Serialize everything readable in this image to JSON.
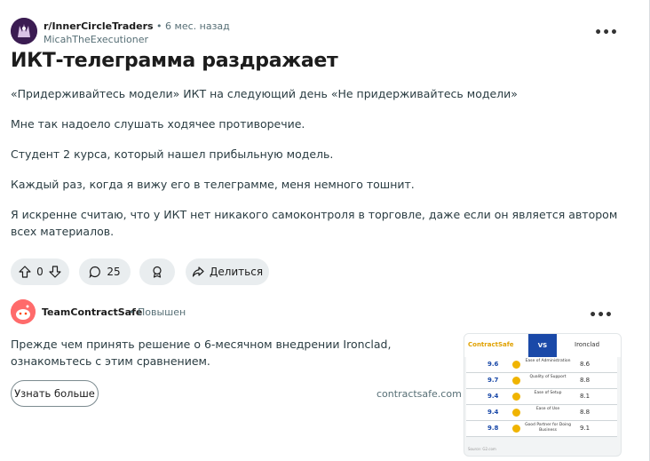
{
  "post": {
    "subreddit": "r/InnerCircleTraders",
    "separator": " • ",
    "age": "6 мес. назад",
    "author": "MicahTheExecutioner",
    "title": "ИКТ-телеграмма раздражает",
    "paragraphs": [
      "«Придерживайтесь модели» ИКТ на следующий день «Не придерживайтесь модели»",
      "Мне так надоело слушать ходячее противоречие.",
      "Студент 2 курса, который нашел прибыльную модель.",
      "Каждый раз, когда я вижу его в телеграмме, меня немного тошнит.",
      "Я искренне считаю, что у ИКТ нет никакого самоконтроля в торговле, даже если он является автором всех материалов."
    ],
    "more_glyph": "•••",
    "actions": {
      "vote_count": "0",
      "comment_count": "25",
      "share_label": "Делиться"
    }
  },
  "ad": {
    "advertiser": "TeamContractSafe",
    "promoted_label": "• Повышен",
    "text": "Прежде чем принять решение о 6-месячном внедрении Ironclad, ознакомьтесь с этим сравнением.",
    "cta_label": "Узнать больше",
    "domain": "contractsafe.com",
    "more_glyph": "•••",
    "thumbnail": {
      "left_brand": "ContractSafe",
      "vs": "VS",
      "right_brand": "Ironclad",
      "rows": [
        {
          "left": "9.6",
          "label": "Ease of Administration",
          "right": "8.6"
        },
        {
          "left": "9.7",
          "label": "Quality of Support",
          "right": "8.8"
        },
        {
          "left": "9.4",
          "label": "Ease of Setup",
          "right": "8.1"
        },
        {
          "left": "9.4",
          "label": "Ease of Use",
          "right": "8.8"
        },
        {
          "left": "9.8",
          "label": "Good Partner for Doing Business",
          "right": "9.1"
        }
      ],
      "footer": "Source: G2.com"
    }
  },
  "colors": {
    "pill_bg": "#e9edef",
    "meta_text": "#576f76",
    "accent_blue": "#1a49a8",
    "accent_yellow": "#f0b400"
  }
}
